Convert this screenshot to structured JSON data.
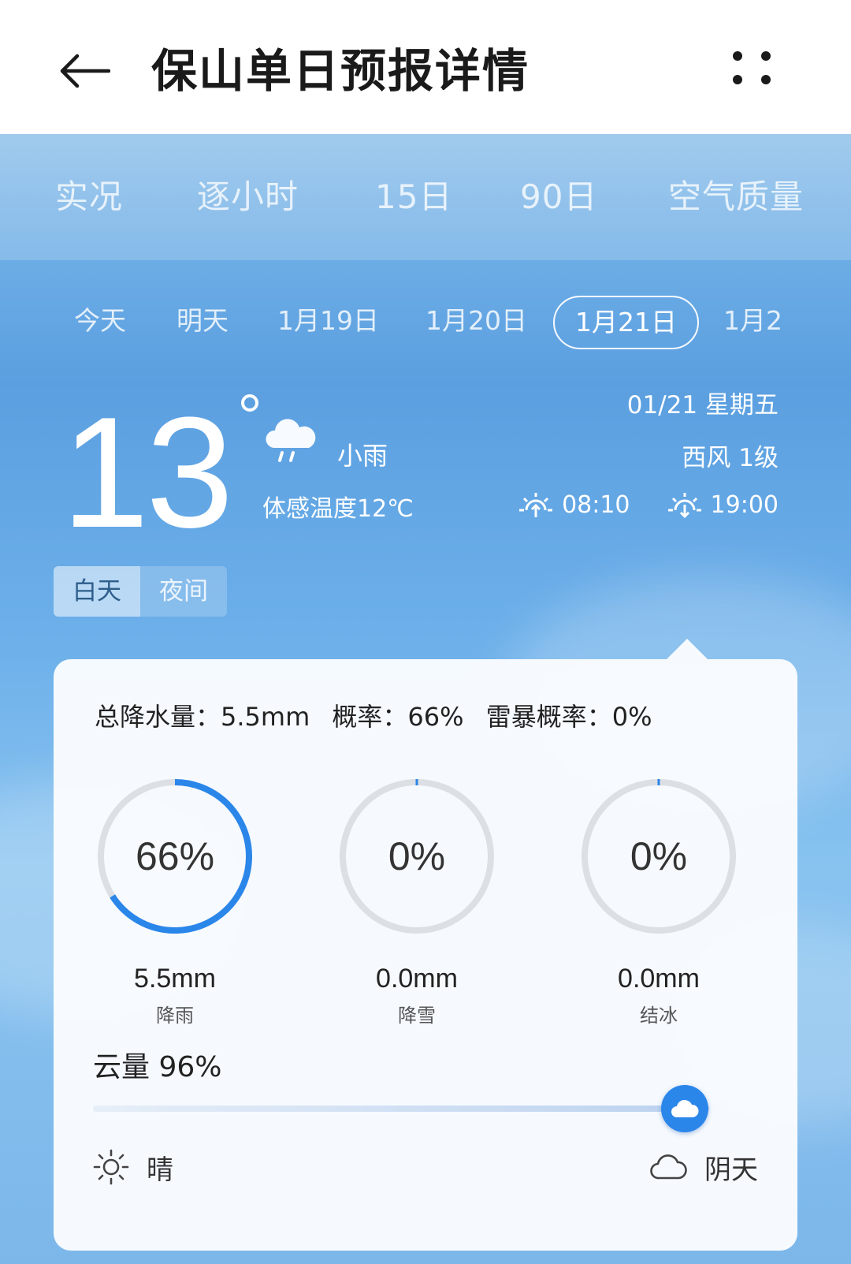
{
  "header": {
    "title": "保山单日预报详情",
    "back_icon": "back-arrow-icon",
    "more_icon": "more-dots-icon"
  },
  "main_tabs": [
    "实况",
    "逐小时",
    "15日",
    "90日",
    "空气质量"
  ],
  "date_tabs": [
    "今天",
    "明天",
    "1月19日",
    "1月20日",
    "1月21日",
    "1月2"
  ],
  "selected_date_tab": "1月21日",
  "current": {
    "temperature": "13",
    "condition": "小雨",
    "condition_icon": "light-rain-icon",
    "feels_like": "体感温度12℃",
    "date_weekday": "01/21 星期五",
    "wind": "西风 1级",
    "sunrise": "08:10",
    "sunset": "19:00"
  },
  "day_night": {
    "day": "白天",
    "night": "夜间",
    "selected": "白天"
  },
  "detail": {
    "summary": {
      "total_precip": "总降水量：5.5mm",
      "probability": "概率：66%",
      "thunder_probability": "雷暴概率：0%"
    },
    "gauges": [
      {
        "percent_text": "66%",
        "percent": 66,
        "amount": "5.5mm",
        "label": "降雨"
      },
      {
        "percent_text": "0%",
        "percent": 0,
        "amount": "0.0mm",
        "label": "降雪"
      },
      {
        "percent_text": "0%",
        "percent": 0,
        "amount": "0.0mm",
        "label": "结冰"
      }
    ],
    "cloud_cover": {
      "title": "云量 96%",
      "percent": 96,
      "left_label": "晴",
      "right_label": "阴天"
    }
  },
  "colors": {
    "accent": "#2b86ea",
    "ring_track": "#dcdfe3",
    "text_dark": "#222222"
  }
}
